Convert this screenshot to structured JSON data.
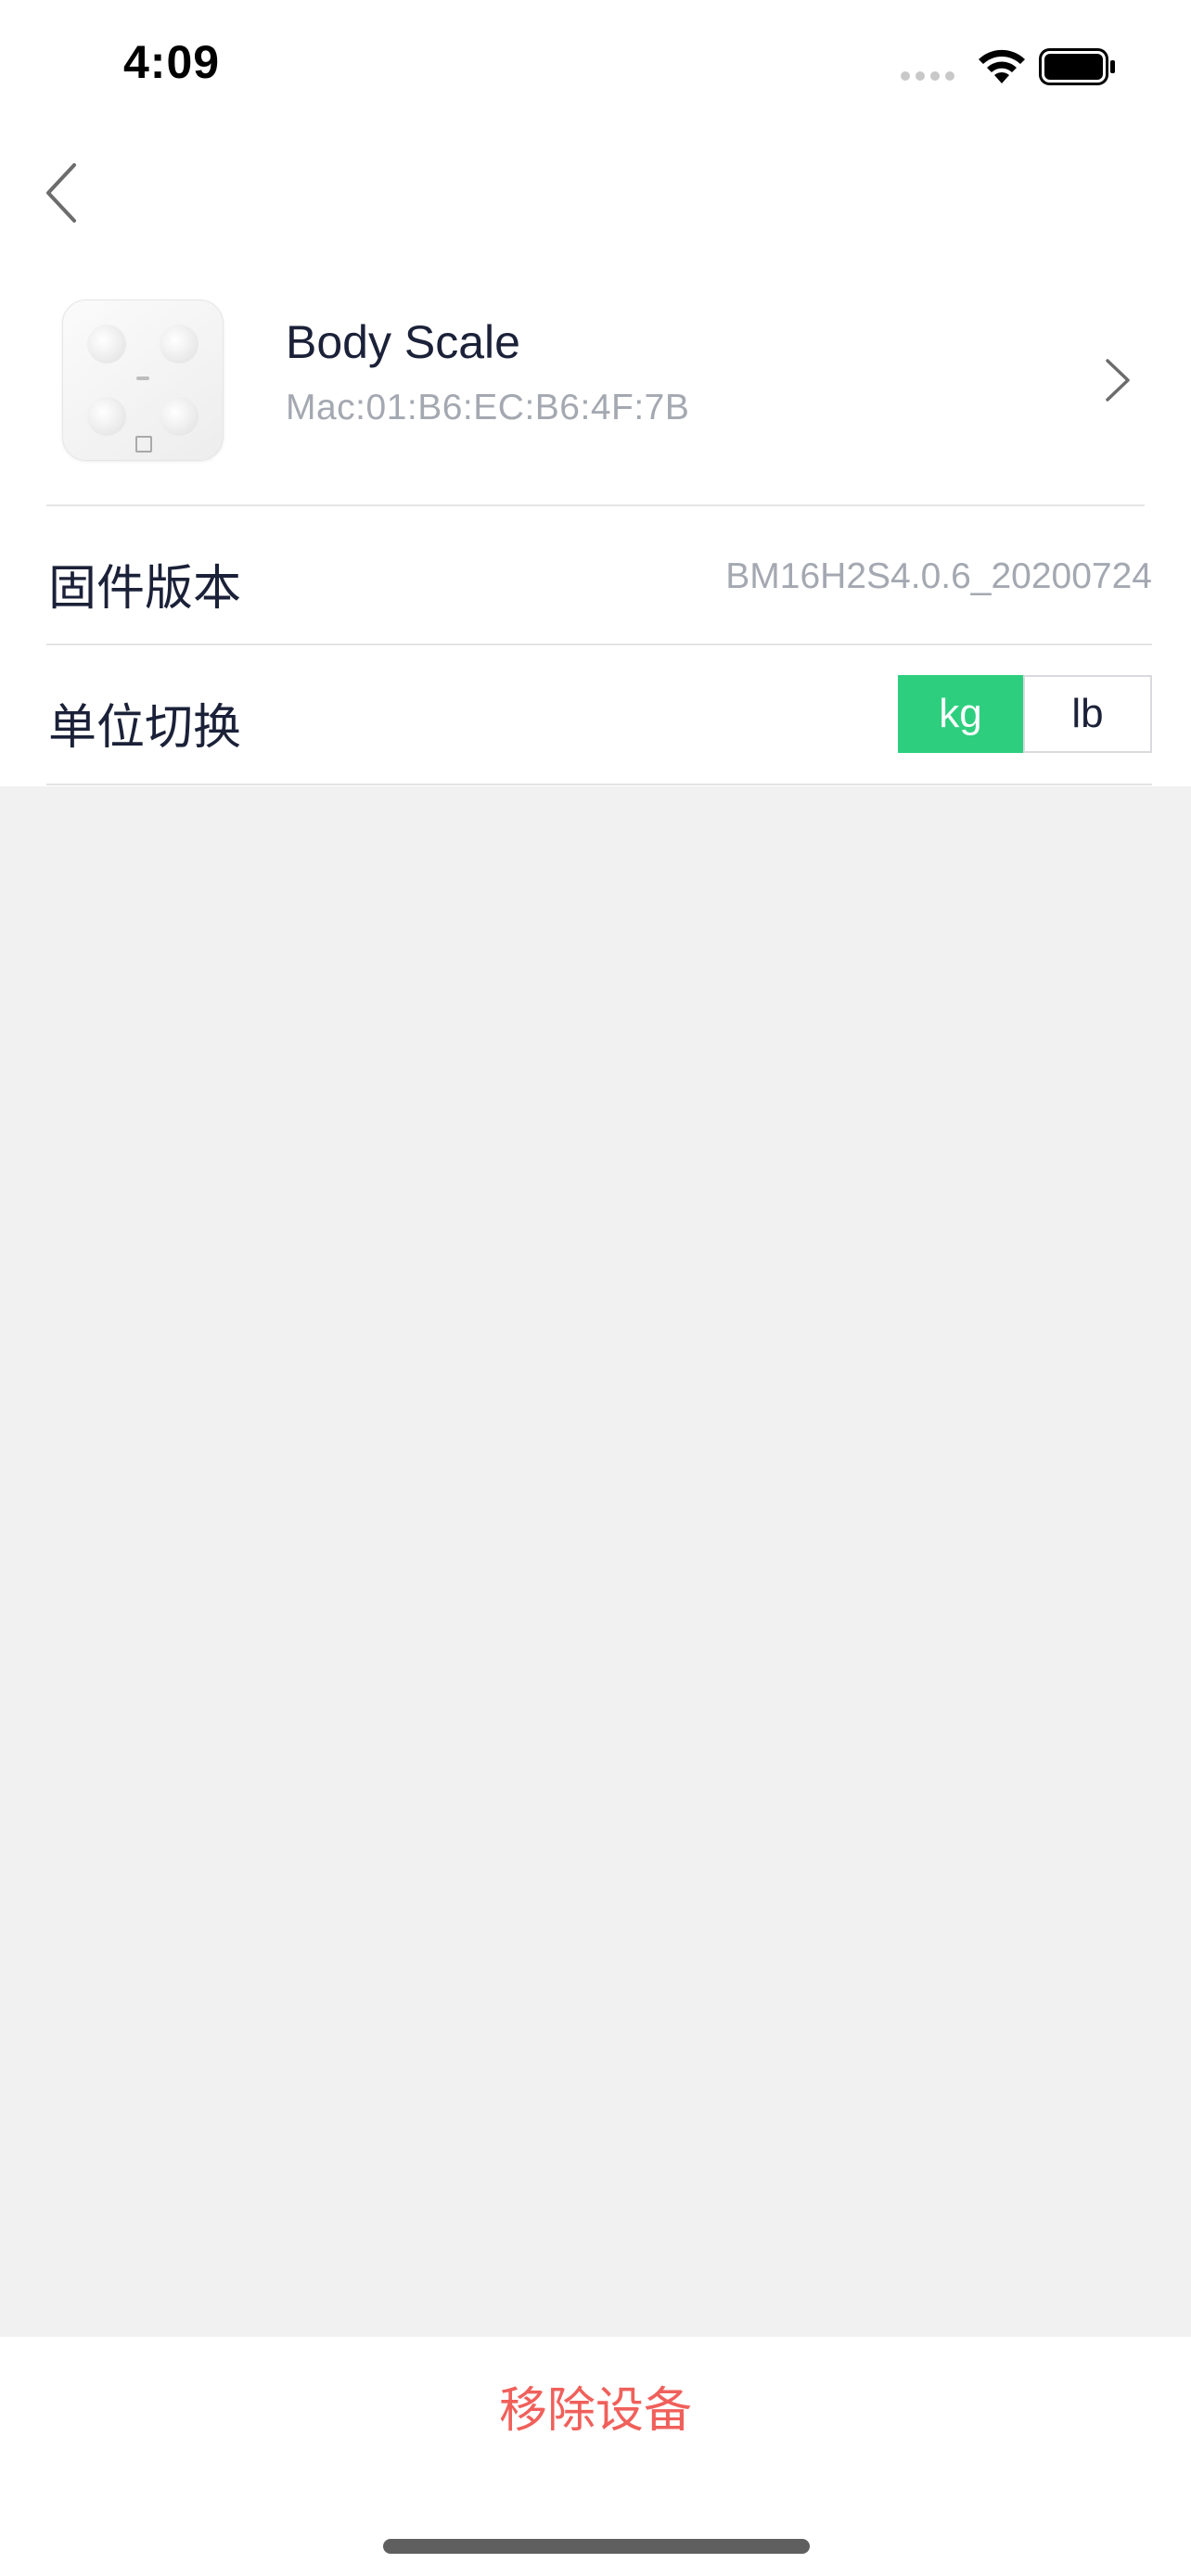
{
  "status_bar": {
    "time": "4:09",
    "icons": [
      "signal-dots-icon",
      "wifi-icon",
      "battery-icon"
    ]
  },
  "nav": {
    "back_icon": "chevron-left-icon"
  },
  "device": {
    "name": "Body Scale",
    "mac": "Mac:01:B6:EC:B6:4F:7B",
    "thumbnail": "body-scale-image",
    "chevron_icon": "chevron-right-icon"
  },
  "settings": {
    "firmware": {
      "label": "固件版本",
      "value": "BM16H2S4.0.6_20200724"
    },
    "unit": {
      "label": "单位切换",
      "options": [
        "kg",
        "lb"
      ],
      "selected": "kg"
    }
  },
  "footer": {
    "remove_label": "移除设备"
  },
  "colors": {
    "accent_green": "#2dcf7f",
    "danger_red": "#f0605b",
    "primary_text": "#1b2138",
    "secondary_text": "#a4a8b1",
    "content_background": "#f1f1f1"
  }
}
